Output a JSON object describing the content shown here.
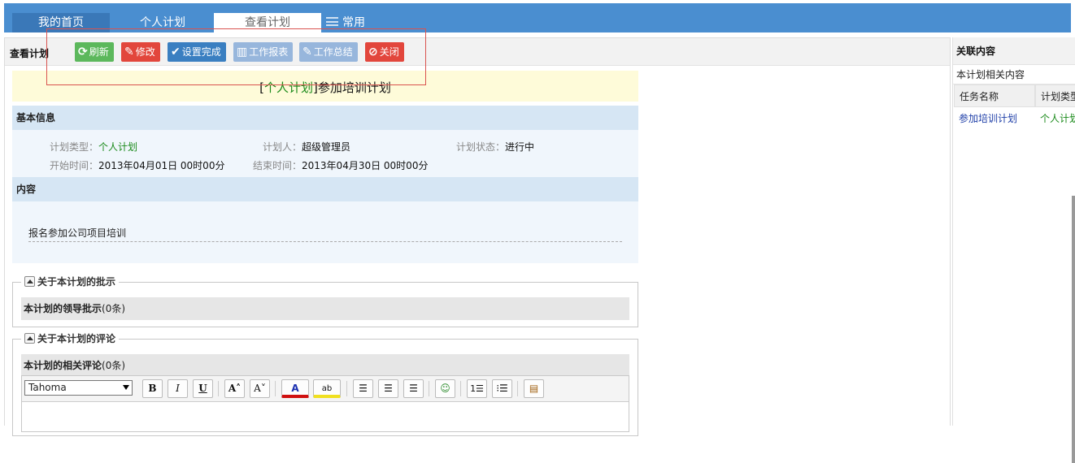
{
  "tabs": {
    "home": "我的首页",
    "personal_plan": "个人计划",
    "view_plan": "查看计划",
    "common": "常用"
  },
  "toolbar": {
    "title": "查看计划",
    "refresh": "刷新",
    "edit": "修改",
    "set_done": "设置完成",
    "work_report": "工作报表",
    "work_summary": "工作总结",
    "close": "关闭"
  },
  "plan": {
    "title_prefix": "[",
    "title_type": "个人计划",
    "title_suffix": "]",
    "title_name": "参加培训计划"
  },
  "basic": {
    "header": "基本信息",
    "plan_type_label": "计划类型：",
    "plan_type_value": "个人计划",
    "planner_label": "计划人：",
    "planner_value": "超级管理员",
    "status_label": "计划状态：",
    "status_value": "进行中",
    "start_label": "开始时间：",
    "start_value": "2013年04月01日 00时00分",
    "end_label": "结束时间：",
    "end_value": "2013年04月30日 00时00分"
  },
  "content": {
    "header": "内容",
    "text": "报名参加公司项目培训"
  },
  "approval": {
    "legend": "关于本计划的批示",
    "header": "本计划的领导批示",
    "count": "(0条)"
  },
  "comments": {
    "legend": "关于本计划的评论",
    "header": "本计划的相关评论",
    "count": "(0条)",
    "font": "Tahoma"
  },
  "related": {
    "title": "关联内容",
    "subtitle": "本计划相关内容",
    "col_task": "任务名称",
    "col_type": "计划类型",
    "row_task": "参加培训计划",
    "row_type": "个人计划"
  },
  "colors": {
    "tab_bar": "#4a8ed0",
    "green_text": "#1a8a1a",
    "link_blue": "#1f3fa8",
    "btn_green": "#5cb85c",
    "btn_red": "#e2463c",
    "btn_blue": "#3a7fc1",
    "btn_disabled": "#97b6dc"
  }
}
